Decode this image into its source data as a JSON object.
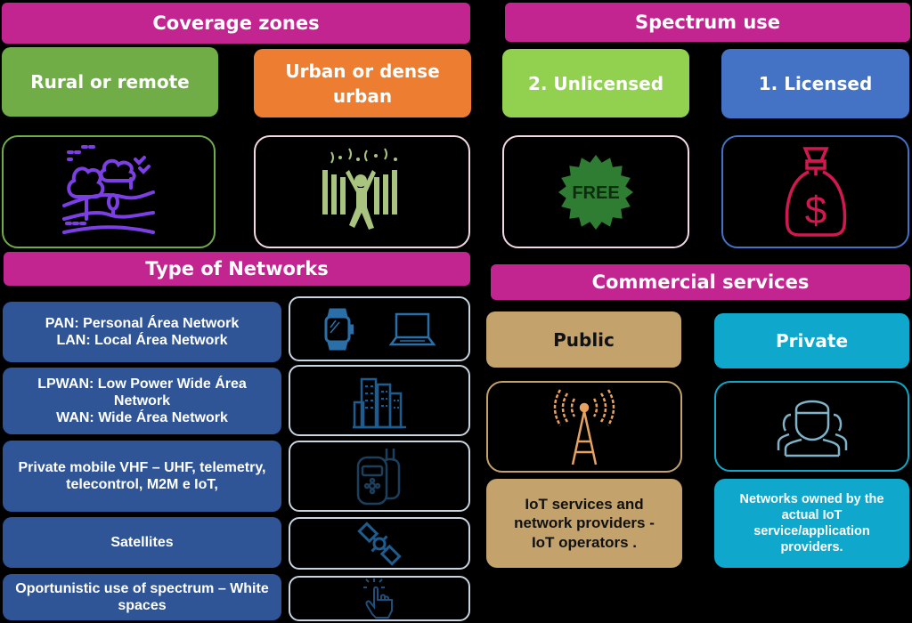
{
  "coverage": {
    "title": "Coverage zones",
    "rural": {
      "label": "Rural or remote",
      "color": "#70ad47",
      "icon": "landscape-icon"
    },
    "urban": {
      "label": "Urban or dense urban",
      "color": "#ed7d31",
      "icon": "crowd-icon"
    }
  },
  "spectrum": {
    "title": "Spectrum use",
    "unlicensed": {
      "label": "2. Unlicensed",
      "color": "#92d050",
      "icon": "free-badge-icon",
      "icon_text": "FREE"
    },
    "licensed": {
      "label": "1. Licensed",
      "color": "#4472c4",
      "icon": "money-bag-icon",
      "icon_text": "$"
    }
  },
  "networks": {
    "title": "Type of Networks",
    "items": [
      {
        "lines": [
          "PAN: Personal Área Network",
          "LAN: Local Área Network"
        ],
        "icons": [
          "smartwatch-icon",
          "laptop-icon"
        ]
      },
      {
        "lines": [
          "LPWAN: Low Power Wide Área",
          "Network",
          "WAN: Wide Área Network"
        ],
        "icons": [
          "city-buildings-icon"
        ]
      },
      {
        "lines": [
          "Private mobile VHF – UHF, telemetry,",
          "telecontrol, M2M e IoT,"
        ],
        "icons": [
          "walkie-talkie-icon"
        ]
      },
      {
        "lines": [
          "Satellites"
        ],
        "icons": [
          "satellite-icon"
        ]
      },
      {
        "lines": [
          "Oportunistic use of  spectrum – White",
          "spaces"
        ],
        "icons": [
          "tap-hand-icon"
        ]
      }
    ]
  },
  "commercial": {
    "title": "Commercial services",
    "public": {
      "label": "Public",
      "color": "#c3a26b",
      "icon": "antenna-tower-icon",
      "description": [
        "IoT services and",
        "network providers  -",
        "IoT operators  ."
      ]
    },
    "private": {
      "label": "Private",
      "color": "#0fa8cc",
      "icon": "user-group-icon",
      "description": [
        "Networks owned by the",
        "actual IoT",
        "service/application",
        "providers."
      ]
    }
  }
}
